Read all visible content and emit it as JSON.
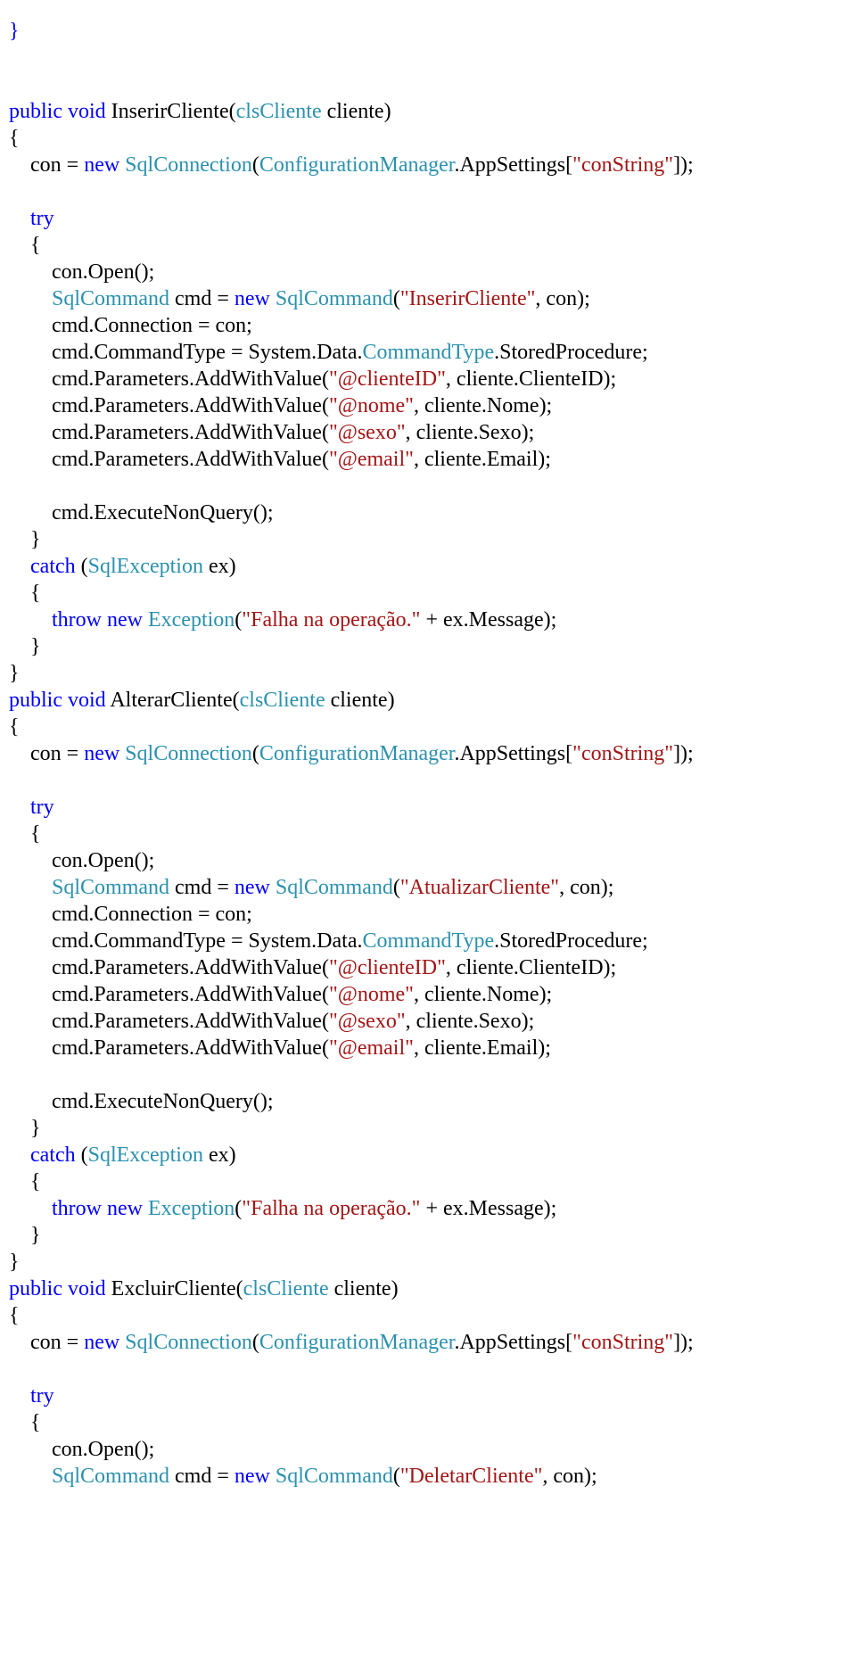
{
  "code_tokens": [
    {
      "t": "}",
      "c": "kw"
    },
    {
      "br": 1
    },
    {
      "br": 1
    },
    {
      "br": 1
    },
    {
      "t": "public",
      "c": "kw"
    },
    {
      "t": " "
    },
    {
      "t": "void",
      "c": "kw"
    },
    {
      "t": " InserirCliente("
    },
    {
      "t": "clsCliente",
      "c": "type"
    },
    {
      "t": " cliente)"
    },
    {
      "br": 1
    },
    {
      "t": "{"
    },
    {
      "br": 1
    },
    {
      "t": "    con = "
    },
    {
      "t": "new",
      "c": "kw"
    },
    {
      "t": " "
    },
    {
      "t": "SqlConnection",
      "c": "type"
    },
    {
      "t": "("
    },
    {
      "t": "ConfigurationManager",
      "c": "type"
    },
    {
      "t": ".AppSettings["
    },
    {
      "t": "\"conString\"",
      "c": "str"
    },
    {
      "t": "]);"
    },
    {
      "br": 1
    },
    {
      "br": 1
    },
    {
      "t": "    "
    },
    {
      "t": "try",
      "c": "kw"
    },
    {
      "br": 1
    },
    {
      "t": "    {"
    },
    {
      "br": 1
    },
    {
      "t": "        con.Open();"
    },
    {
      "br": 1
    },
    {
      "t": "        "
    },
    {
      "t": "SqlCommand",
      "c": "type"
    },
    {
      "t": " cmd = "
    },
    {
      "t": "new",
      "c": "kw"
    },
    {
      "t": " "
    },
    {
      "t": "SqlCommand",
      "c": "type"
    },
    {
      "t": "("
    },
    {
      "t": "\"InserirCliente\"",
      "c": "str"
    },
    {
      "t": ", con);"
    },
    {
      "br": 1
    },
    {
      "t": "        cmd.Connection = con;"
    },
    {
      "br": 1
    },
    {
      "t": "        cmd.CommandType = System.Data."
    },
    {
      "t": "CommandType",
      "c": "type"
    },
    {
      "t": ".StoredProcedure;"
    },
    {
      "br": 1
    },
    {
      "t": "        cmd.Parameters.AddWithValue("
    },
    {
      "t": "\"@clienteID\"",
      "c": "str"
    },
    {
      "t": ", cliente.ClienteID);"
    },
    {
      "br": 1
    },
    {
      "t": "        cmd.Parameters.AddWithValue("
    },
    {
      "t": "\"@nome\"",
      "c": "str"
    },
    {
      "t": ", cliente.Nome);"
    },
    {
      "br": 1
    },
    {
      "t": "        cmd.Parameters.AddWithValue("
    },
    {
      "t": "\"@sexo\"",
      "c": "str"
    },
    {
      "t": ", cliente.Sexo);"
    },
    {
      "br": 1
    },
    {
      "t": "        cmd.Parameters.AddWithValue("
    },
    {
      "t": "\"@email\"",
      "c": "str"
    },
    {
      "t": ", cliente.Email);"
    },
    {
      "br": 1
    },
    {
      "br": 1
    },
    {
      "t": "        cmd.ExecuteNonQuery();"
    },
    {
      "br": 1
    },
    {
      "t": "    }"
    },
    {
      "br": 1
    },
    {
      "t": "    "
    },
    {
      "t": "catch",
      "c": "kw"
    },
    {
      "t": " ("
    },
    {
      "t": "SqlException",
      "c": "type"
    },
    {
      "t": " ex)"
    },
    {
      "br": 1
    },
    {
      "t": "    {"
    },
    {
      "br": 1
    },
    {
      "t": "        "
    },
    {
      "t": "throw",
      "c": "kw"
    },
    {
      "t": " "
    },
    {
      "t": "new",
      "c": "kw"
    },
    {
      "t": " "
    },
    {
      "t": "Exception",
      "c": "type"
    },
    {
      "t": "("
    },
    {
      "t": "\"Falha na operação.\"",
      "c": "str"
    },
    {
      "t": " + ex.Message);"
    },
    {
      "br": 1
    },
    {
      "t": "    }"
    },
    {
      "br": 1
    },
    {
      "t": "}"
    },
    {
      "br": 1
    },
    {
      "t": "public",
      "c": "kw"
    },
    {
      "t": " "
    },
    {
      "t": "void",
      "c": "kw"
    },
    {
      "t": " AlterarCliente("
    },
    {
      "t": "clsCliente",
      "c": "type"
    },
    {
      "t": " cliente)"
    },
    {
      "br": 1
    },
    {
      "t": "{"
    },
    {
      "br": 1
    },
    {
      "t": "    con = "
    },
    {
      "t": "new",
      "c": "kw"
    },
    {
      "t": " "
    },
    {
      "t": "SqlConnection",
      "c": "type"
    },
    {
      "t": "("
    },
    {
      "t": "ConfigurationManager",
      "c": "type"
    },
    {
      "t": ".AppSettings["
    },
    {
      "t": "\"conString\"",
      "c": "str"
    },
    {
      "t": "]);"
    },
    {
      "br": 1
    },
    {
      "br": 1
    },
    {
      "t": "    "
    },
    {
      "t": "try",
      "c": "kw"
    },
    {
      "br": 1
    },
    {
      "t": "    {"
    },
    {
      "br": 1
    },
    {
      "t": "        con.Open();"
    },
    {
      "br": 1
    },
    {
      "t": "        "
    },
    {
      "t": "SqlCommand",
      "c": "type"
    },
    {
      "t": " cmd = "
    },
    {
      "t": "new",
      "c": "kw"
    },
    {
      "t": " "
    },
    {
      "t": "SqlCommand",
      "c": "type"
    },
    {
      "t": "("
    },
    {
      "t": "\"AtualizarCliente\"",
      "c": "str"
    },
    {
      "t": ", con);"
    },
    {
      "br": 1
    },
    {
      "t": "        cmd.Connection = con;"
    },
    {
      "br": 1
    },
    {
      "t": "        cmd.CommandType = System.Data."
    },
    {
      "t": "CommandType",
      "c": "type"
    },
    {
      "t": ".StoredProcedure;"
    },
    {
      "br": 1
    },
    {
      "t": "        cmd.Parameters.AddWithValue("
    },
    {
      "t": "\"@clienteID\"",
      "c": "str"
    },
    {
      "t": ", cliente.ClienteID);"
    },
    {
      "br": 1
    },
    {
      "t": "        cmd.Parameters.AddWithValue("
    },
    {
      "t": "\"@nome\"",
      "c": "str"
    },
    {
      "t": ", cliente.Nome);"
    },
    {
      "br": 1
    },
    {
      "t": "        cmd.Parameters.AddWithValue("
    },
    {
      "t": "\"@sexo\"",
      "c": "str"
    },
    {
      "t": ", cliente.Sexo);"
    },
    {
      "br": 1
    },
    {
      "t": "        cmd.Parameters.AddWithValue("
    },
    {
      "t": "\"@email\"",
      "c": "str"
    },
    {
      "t": ", cliente.Email);"
    },
    {
      "br": 1
    },
    {
      "br": 1
    },
    {
      "t": "        cmd.ExecuteNonQuery();"
    },
    {
      "br": 1
    },
    {
      "t": "    }"
    },
    {
      "br": 1
    },
    {
      "t": "    "
    },
    {
      "t": "catch",
      "c": "kw"
    },
    {
      "t": " ("
    },
    {
      "t": "SqlException",
      "c": "type"
    },
    {
      "t": " ex)"
    },
    {
      "br": 1
    },
    {
      "t": "    {"
    },
    {
      "br": 1
    },
    {
      "t": "        "
    },
    {
      "t": "throw",
      "c": "kw"
    },
    {
      "t": " "
    },
    {
      "t": "new",
      "c": "kw"
    },
    {
      "t": " "
    },
    {
      "t": "Exception",
      "c": "type"
    },
    {
      "t": "("
    },
    {
      "t": "\"Falha na operação.\"",
      "c": "str"
    },
    {
      "t": " + ex.Message);"
    },
    {
      "br": 1
    },
    {
      "t": "    }"
    },
    {
      "br": 1
    },
    {
      "t": "}"
    },
    {
      "br": 1
    },
    {
      "t": "public",
      "c": "kw"
    },
    {
      "t": " "
    },
    {
      "t": "void",
      "c": "kw"
    },
    {
      "t": " ExcluirCliente("
    },
    {
      "t": "clsCliente",
      "c": "type"
    },
    {
      "t": " cliente)"
    },
    {
      "br": 1
    },
    {
      "t": "{"
    },
    {
      "br": 1
    },
    {
      "t": "    con = "
    },
    {
      "t": "new",
      "c": "kw"
    },
    {
      "t": " "
    },
    {
      "t": "SqlConnection",
      "c": "type"
    },
    {
      "t": "("
    },
    {
      "t": "ConfigurationManager",
      "c": "type"
    },
    {
      "t": ".AppSettings["
    },
    {
      "t": "\"conString\"",
      "c": "str"
    },
    {
      "t": "]);"
    },
    {
      "br": 1
    },
    {
      "br": 1
    },
    {
      "t": "    "
    },
    {
      "t": "try",
      "c": "kw"
    },
    {
      "br": 1
    },
    {
      "t": "    {"
    },
    {
      "br": 1
    },
    {
      "t": "        con.Open();"
    },
    {
      "br": 1
    },
    {
      "t": "        "
    },
    {
      "t": "SqlCommand",
      "c": "type"
    },
    {
      "t": " cmd = "
    },
    {
      "t": "new",
      "c": "kw"
    },
    {
      "t": " "
    },
    {
      "t": "SqlCommand",
      "c": "type"
    },
    {
      "t": "("
    },
    {
      "t": "\"DeletarCliente\"",
      "c": "str"
    },
    {
      "t": ", con);"
    }
  ]
}
